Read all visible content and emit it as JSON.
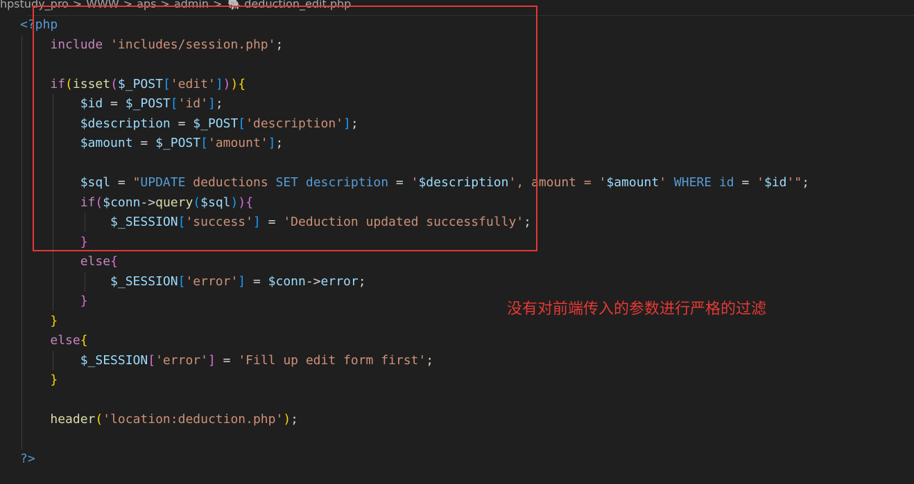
{
  "breadcrumb": {
    "items": [
      "hpstudy_pro",
      "WWW",
      "aps",
      "admin"
    ],
    "separator": ">",
    "file_icon": "php-file-icon",
    "file_icon_glyph": "🐘",
    "file_name": "deduction_edit.php"
  },
  "annotation": {
    "text": "没有对前端传入的参数进行严格的过滤",
    "color": "#e53935"
  },
  "highlight_box_color": "#e53935",
  "code": {
    "language": "php",
    "lines": [
      [
        {
          "t": "<?php",
          "c": "tag"
        }
      ],
      [
        {
          "t": "    "
        },
        {
          "t": "include",
          "c": "kw"
        },
        {
          "t": " "
        },
        {
          "t": "'includes/session.php'",
          "c": "str"
        },
        {
          "t": ";",
          "c": "text"
        }
      ],
      [],
      [
        {
          "t": "    "
        },
        {
          "t": "if",
          "c": "kw"
        },
        {
          "t": "(",
          "c": "y"
        },
        {
          "t": "isset",
          "c": "fn"
        },
        {
          "t": "(",
          "c": "p"
        },
        {
          "t": "$_POST",
          "c": "var"
        },
        {
          "t": "[",
          "c": "b"
        },
        {
          "t": "'edit'",
          "c": "str"
        },
        {
          "t": "]",
          "c": "b"
        },
        {
          "t": ")",
          "c": "p"
        },
        {
          "t": ")",
          "c": "y"
        },
        {
          "t": "{",
          "c": "y"
        }
      ],
      [
        {
          "t": "        "
        },
        {
          "t": "$id",
          "c": "var"
        },
        {
          "t": " = ",
          "c": "op"
        },
        {
          "t": "$_POST",
          "c": "var"
        },
        {
          "t": "[",
          "c": "b"
        },
        {
          "t": "'id'",
          "c": "str"
        },
        {
          "t": "]",
          "c": "b"
        },
        {
          "t": ";",
          "c": "text"
        }
      ],
      [
        {
          "t": "        "
        },
        {
          "t": "$description",
          "c": "var"
        },
        {
          "t": " = ",
          "c": "op"
        },
        {
          "t": "$_POST",
          "c": "var"
        },
        {
          "t": "[",
          "c": "b"
        },
        {
          "t": "'description'",
          "c": "str"
        },
        {
          "t": "]",
          "c": "b"
        },
        {
          "t": ";",
          "c": "text"
        }
      ],
      [
        {
          "t": "        "
        },
        {
          "t": "$amount",
          "c": "var"
        },
        {
          "t": " = ",
          "c": "op"
        },
        {
          "t": "$_POST",
          "c": "var"
        },
        {
          "t": "[",
          "c": "b"
        },
        {
          "t": "'amount'",
          "c": "str"
        },
        {
          "t": "]",
          "c": "b"
        },
        {
          "t": ";",
          "c": "text"
        }
      ],
      [],
      [
        {
          "t": "        "
        },
        {
          "t": "$sql",
          "c": "var"
        },
        {
          "t": " = ",
          "c": "op"
        },
        {
          "t": "\"",
          "c": "str"
        },
        {
          "t": "UPDATE",
          "c": "sql"
        },
        {
          "t": " deductions ",
          "c": "str"
        },
        {
          "t": "SET",
          "c": "sql"
        },
        {
          "t": " ",
          "c": "str"
        },
        {
          "t": "description",
          "c": "sql"
        },
        {
          "t": " = ",
          "c": "op"
        },
        {
          "t": "'",
          "c": "str"
        },
        {
          "t": "$description",
          "c": "var"
        },
        {
          "t": "', amount = '",
          "c": "str"
        },
        {
          "t": "$amount",
          "c": "var"
        },
        {
          "t": "' ",
          "c": "str"
        },
        {
          "t": "WHERE",
          "c": "sql"
        },
        {
          "t": " ",
          "c": "str"
        },
        {
          "t": "id",
          "c": "sql"
        },
        {
          "t": " = ",
          "c": "op"
        },
        {
          "t": "'",
          "c": "str"
        },
        {
          "t": "$id",
          "c": "var"
        },
        {
          "t": "'\"",
          "c": "str"
        },
        {
          "t": ";",
          "c": "text"
        }
      ],
      [
        {
          "t": "        "
        },
        {
          "t": "if",
          "c": "kw"
        },
        {
          "t": "(",
          "c": "p"
        },
        {
          "t": "$conn",
          "c": "var"
        },
        {
          "t": "->",
          "c": "op"
        },
        {
          "t": "query",
          "c": "fn"
        },
        {
          "t": "(",
          "c": "b"
        },
        {
          "t": "$sql",
          "c": "var"
        },
        {
          "t": ")",
          "c": "b"
        },
        {
          "t": ")",
          "c": "p"
        },
        {
          "t": "{",
          "c": "p"
        }
      ],
      [
        {
          "t": "            "
        },
        {
          "t": "$_SESSION",
          "c": "var"
        },
        {
          "t": "[",
          "c": "b"
        },
        {
          "t": "'success'",
          "c": "str"
        },
        {
          "t": "]",
          "c": "b"
        },
        {
          "t": " = ",
          "c": "op"
        },
        {
          "t": "'Deduction updated successfully'",
          "c": "str"
        },
        {
          "t": ";",
          "c": "text"
        }
      ],
      [
        {
          "t": "        "
        },
        {
          "t": "}",
          "c": "p"
        }
      ],
      [
        {
          "t": "        "
        },
        {
          "t": "else",
          "c": "kw"
        },
        {
          "t": "{",
          "c": "p"
        }
      ],
      [
        {
          "t": "            "
        },
        {
          "t": "$_SESSION",
          "c": "var"
        },
        {
          "t": "[",
          "c": "b"
        },
        {
          "t": "'error'",
          "c": "str"
        },
        {
          "t": "]",
          "c": "b"
        },
        {
          "t": " = ",
          "c": "op"
        },
        {
          "t": "$conn",
          "c": "var"
        },
        {
          "t": "->",
          "c": "op"
        },
        {
          "t": "error",
          "c": "var"
        },
        {
          "t": ";",
          "c": "text"
        }
      ],
      [
        {
          "t": "        "
        },
        {
          "t": "}",
          "c": "p"
        }
      ],
      [
        {
          "t": "    "
        },
        {
          "t": "}",
          "c": "y"
        }
      ],
      [
        {
          "t": "    "
        },
        {
          "t": "else",
          "c": "kw"
        },
        {
          "t": "{",
          "c": "y"
        }
      ],
      [
        {
          "t": "        "
        },
        {
          "t": "$_SESSION",
          "c": "var"
        },
        {
          "t": "[",
          "c": "p"
        },
        {
          "t": "'error'",
          "c": "str"
        },
        {
          "t": "]",
          "c": "p"
        },
        {
          "t": " = ",
          "c": "op"
        },
        {
          "t": "'Fill up edit form first'",
          "c": "str"
        },
        {
          "t": ";",
          "c": "text"
        }
      ],
      [
        {
          "t": "    "
        },
        {
          "t": "}",
          "c": "y"
        }
      ],
      [],
      [
        {
          "t": "    "
        },
        {
          "t": "header",
          "c": "fn"
        },
        {
          "t": "(",
          "c": "y"
        },
        {
          "t": "'location:deduction.php'",
          "c": "str"
        },
        {
          "t": ")",
          "c": "y"
        },
        {
          "t": ";",
          "c": "text"
        }
      ],
      [],
      [
        {
          "t": "?>",
          "c": "tag"
        }
      ]
    ]
  }
}
